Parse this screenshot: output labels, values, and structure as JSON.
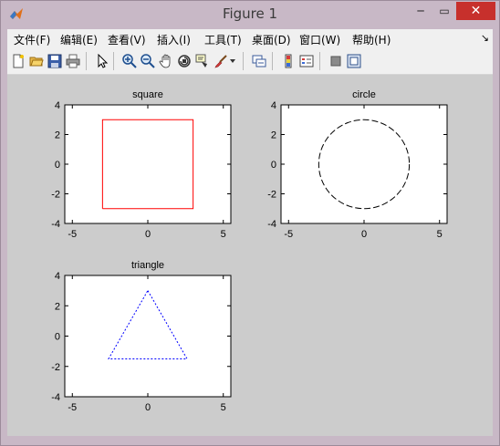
{
  "window": {
    "title": "Figure 1",
    "close_glyph": "✕",
    "minimize_glyph": "─",
    "maximize_glyph": "▭",
    "app_icon": "matlab-logo-icon"
  },
  "menubar": {
    "items": [
      {
        "label": "文件(F)"
      },
      {
        "label": "编辑(E)"
      },
      {
        "label": "查看(V)"
      },
      {
        "label": "插入(I)"
      },
      {
        "label": "工具(T)"
      },
      {
        "label": "桌面(D)"
      },
      {
        "label": "窗口(W)"
      },
      {
        "label": "帮助(H)"
      }
    ],
    "overflow_glyph": "↘"
  },
  "toolbar": {
    "buttons": [
      "new-figure-icon",
      "open-file-icon",
      "save-icon",
      "print-icon",
      "edit-plot-arrow-icon",
      "zoom-in-icon",
      "zoom-out-icon",
      "pan-hand-icon",
      "rotate-3d-icon",
      "data-cursor-icon",
      "brush-icon",
      "brush-dropdown-icon",
      "link-plot-icon",
      "insert-colorbar-icon",
      "insert-legend-icon",
      "hide-plot-tools-icon",
      "show-plot-tools-icon"
    ]
  },
  "colors": {
    "square": "#ff0000",
    "circle": "#000000",
    "triangle": "#0000ff",
    "figure_bg": "#cccccc",
    "axes_bg": "#ffffff"
  },
  "chart_data": [
    {
      "type": "line",
      "title": "square",
      "xlim": [
        -5.5,
        5.5
      ],
      "ylim": [
        -4,
        4
      ],
      "xticks": [
        -5,
        0,
        5
      ],
      "yticks": [
        4,
        2,
        0,
        -2,
        -4
      ],
      "line_style": "solid",
      "color": "#ff0000",
      "x": [
        -3,
        3,
        3,
        -3,
        -3
      ],
      "y": [
        -3,
        -3,
        3,
        3,
        -3
      ]
    },
    {
      "type": "line",
      "title": "circle",
      "xlim": [
        -5.5,
        5.5
      ],
      "ylim": [
        -4,
        4
      ],
      "xticks": [
        -5,
        0,
        5
      ],
      "yticks": [
        4,
        2,
        0,
        -2,
        -4
      ],
      "line_style": "dashed",
      "color": "#000000",
      "shape": "circle",
      "center": [
        0,
        0
      ],
      "radius": 3
    },
    {
      "type": "line",
      "title": "triangle",
      "xlim": [
        -5.5,
        5.5
      ],
      "ylim": [
        -4,
        4
      ],
      "xticks": [
        -5,
        0,
        5
      ],
      "yticks": [
        4,
        2,
        0,
        -2,
        -4
      ],
      "line_style": "dotted",
      "color": "#0000ff",
      "x": [
        0,
        2.6,
        -2.6,
        0
      ],
      "y": [
        3,
        -1.5,
        -1.5,
        3
      ]
    }
  ]
}
